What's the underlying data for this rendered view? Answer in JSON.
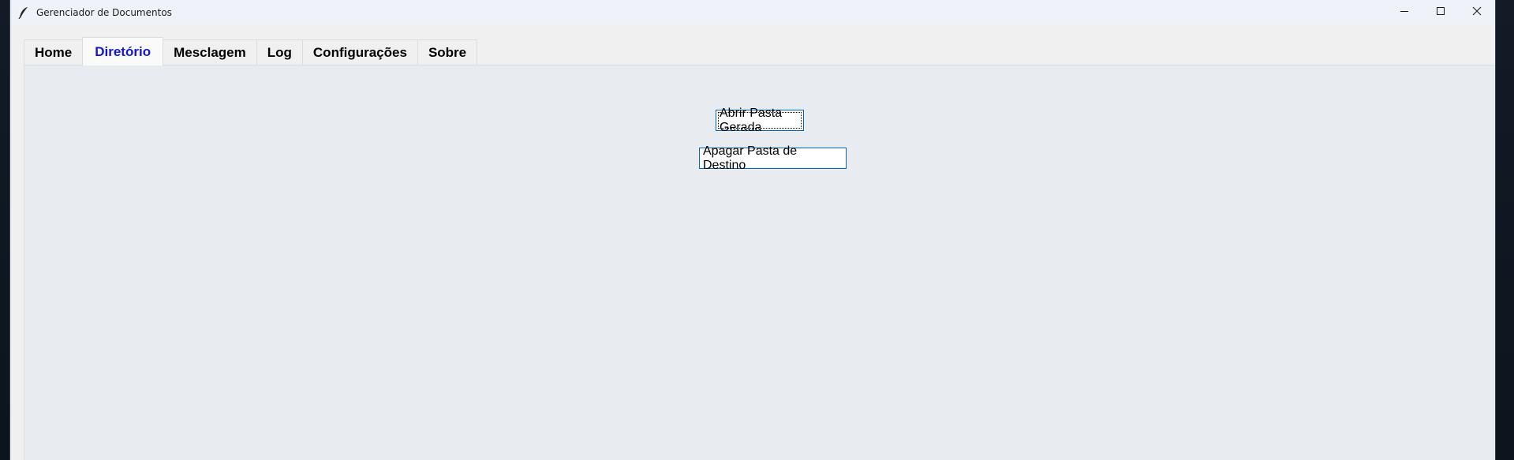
{
  "window": {
    "title": "Gerenciador de Documentos",
    "icon": "feather-icon",
    "controls": [
      "minimize-icon",
      "maximize-icon",
      "close-icon"
    ]
  },
  "tabs": [
    {
      "label": "Home",
      "active": false
    },
    {
      "label": "Diretório",
      "active": true
    },
    {
      "label": "Mesclagem",
      "active": false
    },
    {
      "label": "Log",
      "active": false
    },
    {
      "label": "Configurações",
      "active": false
    },
    {
      "label": "Sobre",
      "active": false
    }
  ],
  "panel": {
    "open_folder_button": "Abrir Pasta Gerada",
    "delete_folder_button": "Apagar Pasta de Destino"
  },
  "colors": {
    "active_tab_text": "#1414d6",
    "button_border": "#0067c0",
    "panel_background": "#e8ecf0",
    "titlebar_background": "#eff3f9"
  }
}
